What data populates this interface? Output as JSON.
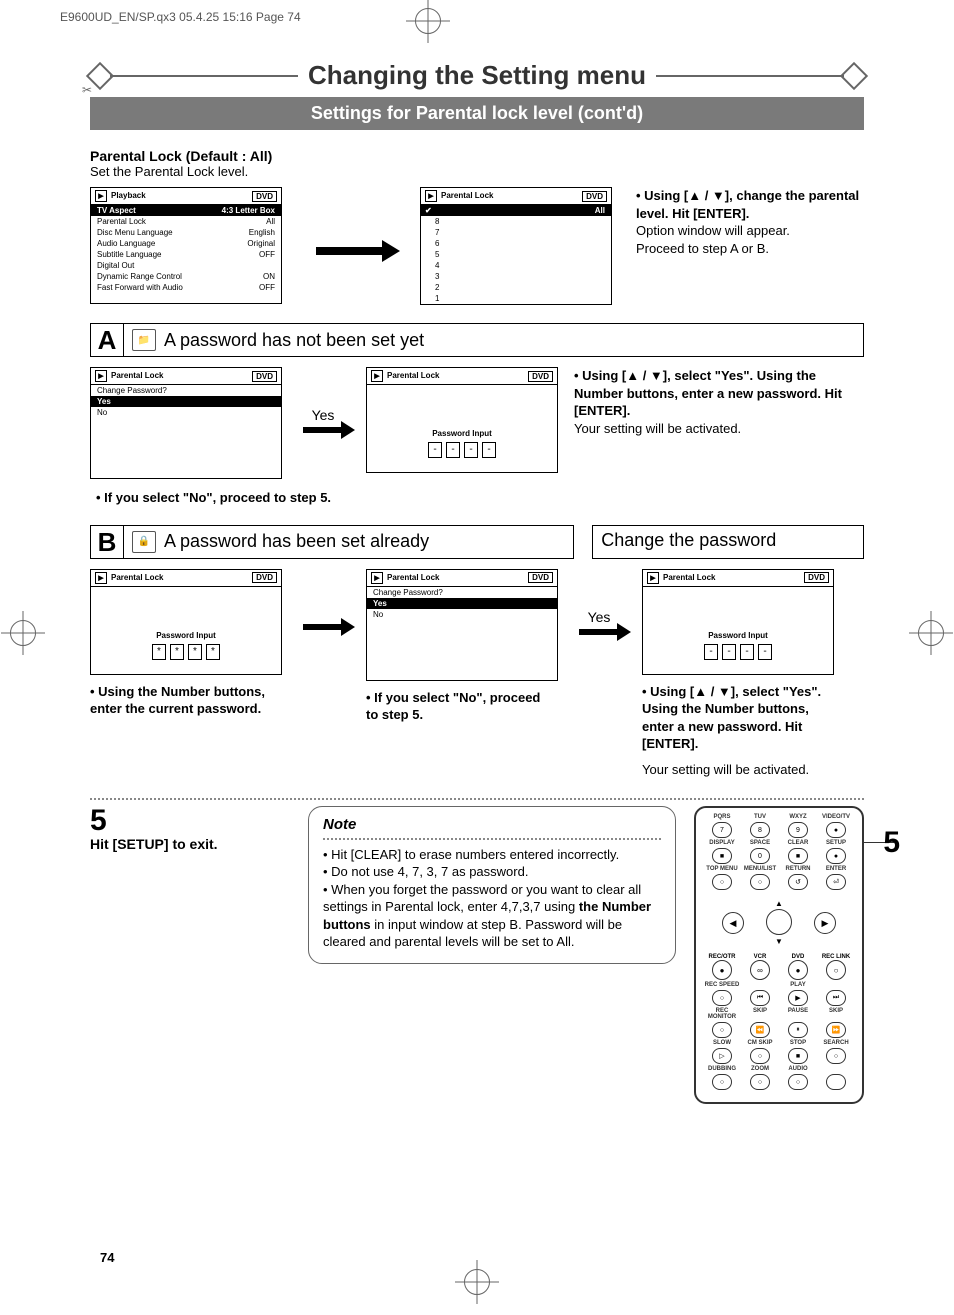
{
  "meta": {
    "header": "E9600UD_EN/SP.qx3  05.4.25 15:16  Page 74",
    "page_number": "74"
  },
  "title": "Changing the Setting menu",
  "subtitle": "Settings for Parental lock level (cont'd)",
  "parental": {
    "heading": "Parental Lock (Default : All)",
    "sub": "Set the Parental Lock level."
  },
  "osd_playback": {
    "header_left": "Playback",
    "header_right": "DVD",
    "rows": [
      [
        "TV Aspect",
        "4:3 Letter Box"
      ],
      [
        "Parental Lock",
        "All"
      ],
      [
        "Disc Menu Language",
        "English"
      ],
      [
        "Audio Language",
        "Original"
      ],
      [
        "Subtitle Language",
        "OFF"
      ],
      [
        "Digital Out",
        ""
      ],
      [
        "Dynamic Range Control",
        "ON"
      ],
      [
        "Fast Forward with Audio",
        "OFF"
      ]
    ],
    "selected": 0
  },
  "osd_levels": {
    "header_left": "Parental Lock",
    "header_right": "DVD",
    "items": [
      "All",
      "8",
      "7",
      "6",
      "5",
      "4",
      "3",
      "2",
      "1"
    ],
    "selected": 0
  },
  "side1": {
    "b1": "• Using [▲ / ▼], change the parental level. Hit [ENTER].",
    "t1": "Option window will appear.",
    "t2": "Proceed to step A or B."
  },
  "sectionA": {
    "letter": "A",
    "text": "A password has not been set yet"
  },
  "osd_changepw": {
    "header_left": "Parental Lock",
    "header_right": "DVD",
    "q": "Change Password?",
    "yes": "Yes",
    "no": "No"
  },
  "yes_label": "Yes",
  "osd_pwinput": {
    "header_left": "Parental Lock",
    "header_right": "DVD",
    "label": "Password Input",
    "dashes": [
      "-",
      "-",
      "-",
      "-"
    ],
    "stars": [
      "*",
      "*",
      "*",
      "*"
    ]
  },
  "sideA": {
    "b1": "• Using [▲ / ▼], select \"Yes\". Using the Number buttons, enter a new password. Hit [ENTER].",
    "t1": "Your setting will be activated."
  },
  "noteA": "• If you select \"No\", proceed to step 5.",
  "sectionB": {
    "letter": "B",
    "text": "A password has been set already",
    "change": "Change the password"
  },
  "captions": {
    "b1": "• Using the Number buttons, enter the current password.",
    "b2": "• If you select \"No\", proceed to step 5.",
    "b3": "• Using [▲ / ▼], select \"Yes\". Using the Number buttons, enter a new password. Hit [ENTER].",
    "b3b": "Your setting will be activated."
  },
  "step5": {
    "num": "5",
    "line": "Hit [SETUP] to exit."
  },
  "note": {
    "label": "Note",
    "l1": "• Hit [CLEAR] to erase numbers entered incorrectly.",
    "l2": "• Do not use 4, 7, 3, 7 as password.",
    "l3a": "• When you forget the password or you want to clear all settings in Parental lock, enter 4,7,3,7 using ",
    "l3b": "the Number buttons",
    "l3c": " in input window at step B. Password will be cleared and parental levels will be set to All."
  },
  "remote": {
    "row1_lbl": [
      "PQRS",
      "TUV",
      "WXYZ",
      "VIDEO/TV"
    ],
    "row1_btn": [
      "7",
      "8",
      "9",
      "●"
    ],
    "row2_lbl": [
      "DISPLAY",
      "SPACE",
      "CLEAR",
      "SETUP"
    ],
    "row2_btn": [
      "■",
      "0",
      "■",
      "●"
    ],
    "row3_lbl": [
      "TOP MENU",
      "MENU/LIST",
      "RETURN",
      "ENTER"
    ],
    "row3_btn": [
      "○",
      "○",
      "↺",
      "⏎"
    ],
    "dpad": {
      "up": "▲",
      "down": "▼",
      "left": "◀",
      "right": "▶"
    },
    "mode_lbl": [
      "REC/OTR",
      "VCR",
      "DVD",
      "REC LINK"
    ],
    "mode_in": [
      "●",
      "∞",
      "●",
      "○"
    ],
    "row4_lbl": [
      "REC SPEED",
      "",
      "PLAY",
      ""
    ],
    "row4_btn": [
      "○",
      "⏮",
      "▶",
      "⏭"
    ],
    "row5_lbl": [
      "REC MONITOR",
      "SKIP",
      "PAUSE",
      "SKIP"
    ],
    "row5_btn": [
      "○",
      "⏪",
      "⏸",
      "⏩"
    ],
    "row6_lbl": [
      "SLOW",
      "CM SKIP",
      "STOP",
      "SEARCH"
    ],
    "row6_btn": [
      "▷",
      "○",
      "■",
      "○"
    ],
    "row7_lbl": [
      "DUBBING",
      "ZOOM",
      "AUDIO",
      ""
    ],
    "row7_btn": [
      "○",
      "○",
      "○",
      ""
    ],
    "callout": "5"
  }
}
